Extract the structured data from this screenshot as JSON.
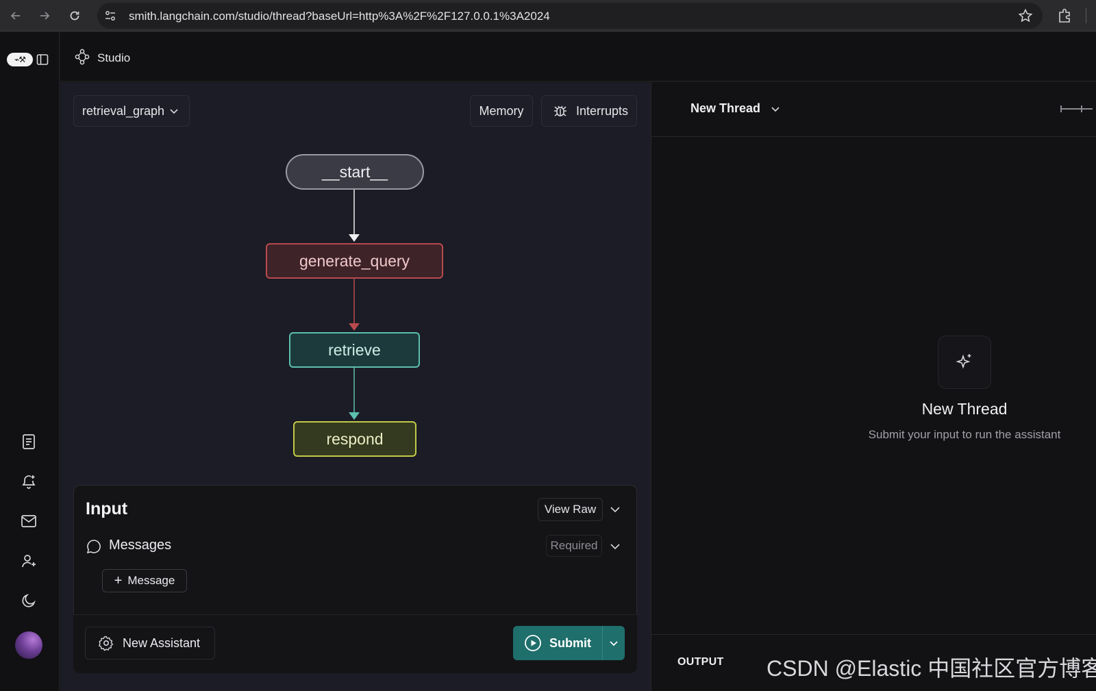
{
  "browser": {
    "url": "smith.langchain.com/studio/thread?baseUrl=http%3A%2F%2F127.0.0.1%3A2024"
  },
  "header": {
    "studio_label": "Studio"
  },
  "graph": {
    "selected_graph": "retrieval_graph",
    "memory_label": "Memory",
    "interrupts_label": "Interrupts",
    "nodes": [
      "__start__",
      "generate_query",
      "retrieve",
      "respond"
    ],
    "colors": {
      "start": "#9a9aa5",
      "generate_query": "#b84a4e",
      "retrieve": "#5cc0b0",
      "respond": "#c3cb48"
    }
  },
  "input": {
    "title": "Input",
    "view_raw_label": "View Raw",
    "messages_label": "Messages",
    "required_label": "Required",
    "add_message_label": "Message"
  },
  "actions": {
    "new_assistant_label": "New Assistant",
    "submit_label": "Submit"
  },
  "thread": {
    "selector_label": "New Thread",
    "empty_title": "New Thread",
    "empty_subtitle": "Submit your input to run the assistant",
    "output_label": "OUTPUT",
    "watermark": "CSDN @Elastic 中国社区官方博客"
  },
  "icons": [
    "back-icon",
    "forward-icon",
    "reload-icon",
    "site-settings-icon",
    "star-icon",
    "extensions-icon",
    "sidebar-toggle-icon",
    "docs-icon",
    "notifications-icon",
    "mail-icon",
    "add-user-icon",
    "moon-icon",
    "studio-graph-icon",
    "bug-icon",
    "chat-bubble-icon",
    "gear-icon",
    "play-circle-icon",
    "sparkle-icon"
  ]
}
